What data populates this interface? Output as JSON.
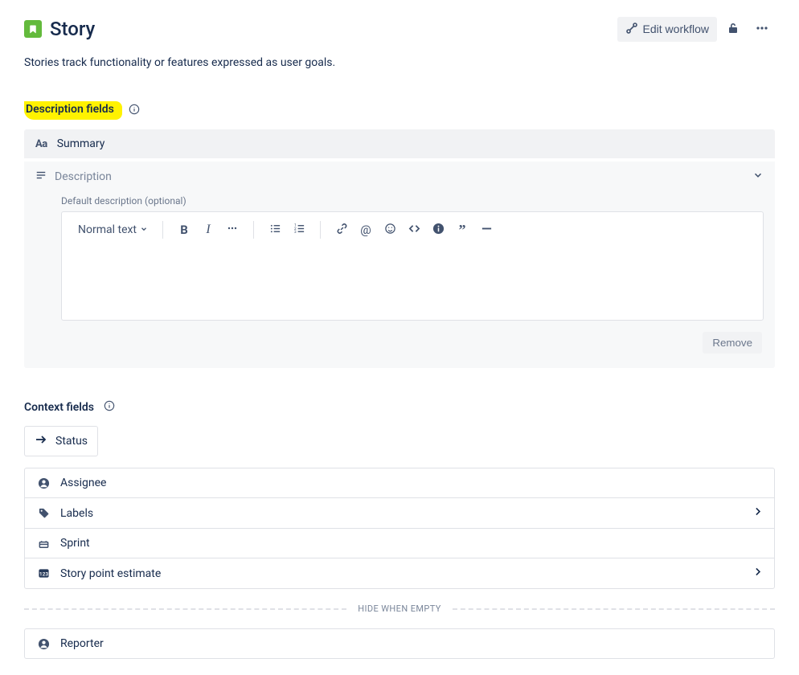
{
  "header": {
    "title": "Story",
    "edit_workflow_label": "Edit workflow"
  },
  "subtitle": "Stories track functionality or features expressed as user goals.",
  "sections": {
    "description_fields_heading": "Description fields",
    "context_fields_heading": "Context fields",
    "hide_when_empty": "HIDE WHEN EMPTY"
  },
  "summary": {
    "aa_label": "Aa",
    "label": "Summary"
  },
  "description": {
    "label": "Description",
    "default_label": "Default description (optional)",
    "normal_text_label": "Normal text",
    "remove_label": "Remove"
  },
  "status": {
    "label": "Status"
  },
  "context_rows": {
    "assignee": "Assignee",
    "labels": "Labels",
    "sprint": "Sprint",
    "story_point": "Story point estimate",
    "reporter": "Reporter"
  }
}
